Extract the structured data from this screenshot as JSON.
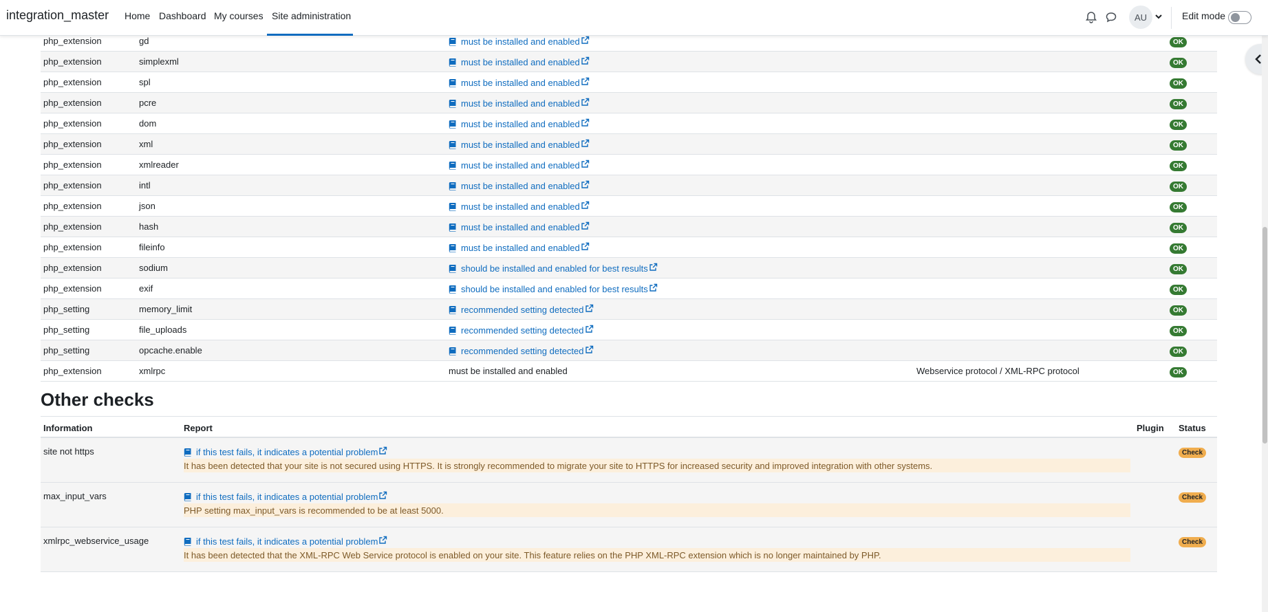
{
  "navbar": {
    "brand": "integration_master",
    "links": [
      "Home",
      "Dashboard",
      "My courses",
      "Site administration"
    ],
    "avatar_initials": "AU",
    "edit_mode_label": "Edit mode"
  },
  "environment_rows": [
    {
      "type": "php_extension",
      "name": "gd",
      "report": "must be installed and enabled",
      "report_is_link": true,
      "plugin": "",
      "status": "OK"
    },
    {
      "type": "php_extension",
      "name": "simplexml",
      "report": "must be installed and enabled",
      "report_is_link": true,
      "plugin": "",
      "status": "OK"
    },
    {
      "type": "php_extension",
      "name": "spl",
      "report": "must be installed and enabled",
      "report_is_link": true,
      "plugin": "",
      "status": "OK"
    },
    {
      "type": "php_extension",
      "name": "pcre",
      "report": "must be installed and enabled",
      "report_is_link": true,
      "plugin": "",
      "status": "OK"
    },
    {
      "type": "php_extension",
      "name": "dom",
      "report": "must be installed and enabled",
      "report_is_link": true,
      "plugin": "",
      "status": "OK"
    },
    {
      "type": "php_extension",
      "name": "xml",
      "report": "must be installed and enabled",
      "report_is_link": true,
      "plugin": "",
      "status": "OK"
    },
    {
      "type": "php_extension",
      "name": "xmlreader",
      "report": "must be installed and enabled",
      "report_is_link": true,
      "plugin": "",
      "status": "OK"
    },
    {
      "type": "php_extension",
      "name": "intl",
      "report": "must be installed and enabled",
      "report_is_link": true,
      "plugin": "",
      "status": "OK"
    },
    {
      "type": "php_extension",
      "name": "json",
      "report": "must be installed and enabled",
      "report_is_link": true,
      "plugin": "",
      "status": "OK"
    },
    {
      "type": "php_extension",
      "name": "hash",
      "report": "must be installed and enabled",
      "report_is_link": true,
      "plugin": "",
      "status": "OK"
    },
    {
      "type": "php_extension",
      "name": "fileinfo",
      "report": "must be installed and enabled",
      "report_is_link": true,
      "plugin": "",
      "status": "OK"
    },
    {
      "type": "php_extension",
      "name": "sodium",
      "report": "should be installed and enabled for best results",
      "report_is_link": true,
      "plugin": "",
      "status": "OK"
    },
    {
      "type": "php_extension",
      "name": "exif",
      "report": "should be installed and enabled for best results",
      "report_is_link": true,
      "plugin": "",
      "status": "OK"
    },
    {
      "type": "php_setting",
      "name": "memory_limit",
      "report": "recommended setting detected",
      "report_is_link": true,
      "plugin": "",
      "status": "OK"
    },
    {
      "type": "php_setting",
      "name": "file_uploads",
      "report": "recommended setting detected",
      "report_is_link": true,
      "plugin": "",
      "status": "OK"
    },
    {
      "type": "php_setting",
      "name": "opcache.enable",
      "report": "recommended setting detected",
      "report_is_link": true,
      "plugin": "",
      "status": "OK"
    },
    {
      "type": "php_extension",
      "name": "xmlrpc",
      "report": "must be installed and enabled",
      "report_is_link": false,
      "plugin": "Webservice protocol / XML-RPC protocol",
      "status": "OK"
    }
  ],
  "other_checks": {
    "title": "Other checks",
    "headers": {
      "information": "Information",
      "report": "Report",
      "plugin": "Plugin",
      "status": "Status"
    },
    "rows": [
      {
        "info": "site not https",
        "report_link": "if this test fails, it indicates a potential problem",
        "message": "It has been detected that your site is not secured using HTTPS. It is strongly recommended to migrate your site to HTTPS for increased security and improved integration with other systems.",
        "status": "Check"
      },
      {
        "info": "max_input_vars",
        "report_link": "if this test fails, it indicates a potential problem",
        "message": "PHP setting max_input_vars is recommended to be at least 5000.",
        "status": "Check"
      },
      {
        "info": "xmlrpc_webservice_usage",
        "report_link": "if this test fails, it indicates a potential problem",
        "message": "It has been detected that the XML-RPC Web Service protocol is enabled on your site. This feature relies on the PHP XML-RPC extension which is no longer maintained by PHP.",
        "status": "Check"
      }
    ]
  },
  "colors": {
    "link": "#0f6cbf",
    "ok_badge": "#357a32",
    "check_badge": "#f0ad4e",
    "warning_bg": "#fcefdc"
  }
}
